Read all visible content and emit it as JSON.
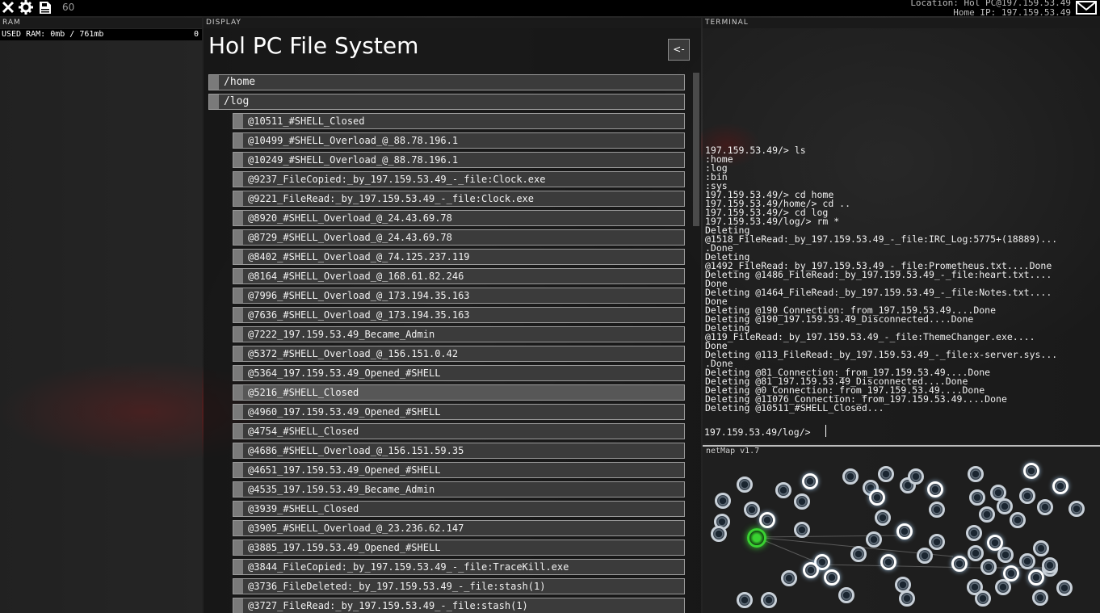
{
  "topbar": {
    "fps": "60",
    "location_line": "Location: Hol PC@197.159.53.49",
    "home_ip_line": "Home IP: 197.159.53.49",
    "icons": [
      "close-icon",
      "gear-icon",
      "save-icon",
      "mail-icon"
    ]
  },
  "ram": {
    "label": "RAM",
    "used_label": "USED RAM: 0mb / 761mb",
    "count": "0"
  },
  "display": {
    "label": "DISPLAY",
    "title": "Hol PC File System",
    "back_label": "<-",
    "dirs": [
      "/home",
      "/log"
    ],
    "files": [
      "@10511_#SHELL_Closed",
      "@10499_#SHELL_Overload_@_88.78.196.1",
      "@10249_#SHELL_Overload_@_88.78.196.1",
      "@9237_FileCopied:_by_197.159.53.49_-_file:Clock.exe",
      "@9221_FileRead:_by_197.159.53.49_-_file:Clock.exe",
      "@8920_#SHELL_Overload_@_24.43.69.78",
      "@8729_#SHELL_Overload_@_24.43.69.78",
      "@8402_#SHELL_Overload_@_74.125.237.119",
      "@8164_#SHELL_Overload_@_168.61.82.246",
      "@7996_#SHELL_Overload_@_173.194.35.163",
      "@7636_#SHELL_Overload_@_173.194.35.163",
      "@7222_197.159.53.49_Became_Admin",
      "@5372_#SHELL_Overload_@_156.151.0.42",
      "@5364_197.159.53.49_Opened_#SHELL",
      "@5216_#SHELL_Closed",
      "@4960_197.159.53.49_Opened_#SHELL",
      "@4754_#SHELL_Closed",
      "@4686_#SHELL_Overload_@_156.151.59.35",
      "@4651_197.159.53.49_Opened_#SHELL",
      "@4535_197.159.53.49_Became_Admin",
      "@3939_#SHELL_Closed",
      "@3905_#SHELL_Overload_@_23.236.62.147",
      "@3885_197.159.53.49_Opened_#SHELL",
      "@3844_FileCopied:_by_197.159.53.49_-_file:TraceKill.exe",
      "@3736_FileDeleted:_by_197.159.53.49_-_file:stash(1)",
      "@3727_FileRead:_by_197.159.53.49_-_file:stash(1)"
    ]
  },
  "terminal": {
    "label": "TERMINAL",
    "lines": [
      "197.159.53.49/> ls",
      ":home",
      ":log",
      ":bin",
      ":sys",
      "197.159.53.49/> cd home",
      "197.159.53.49/home/> cd ..",
      "197.159.53.49/> cd log",
      "197.159.53.49/log/> rm *",
      "Deleting",
      "@1518_FileRead:_by_197.159.53.49_-_file:IRC_Log:5775+(18889)...",
      ".Done",
      "Deleting",
      "@1492_FileRead:_by_197.159.53.49_-_file:Prometheus.txt....Done",
      "Deleting @1486_FileRead:_by_197.159.53.49_-_file:heart.txt....",
      "Done",
      "Deleting @1464_FileRead:_by_197.159.53.49_-_file:Notes.txt....",
      "Done",
      "Deleting @190_Connection:_from_197.159.53.49....Done",
      "Deleting @190_197.159.53.49_Disconnected....Done",
      "Deleting",
      "@119_FileRead:_by_197.159.53.49_-_file:ThemeChanger.exe....",
      "Done",
      "Deleting @113_FileRead:_by_197.159.53.49_-_file:x-server.sys...",
      ".Done",
      "Deleting @81_Connection:_from_197.159.53.49....Done",
      "Deleting @81_197.159.53.49_Disconnected....Done",
      "Deleting @0_Connection:_from_197.159.53.49....Done",
      "Deleting @11076_Connection:_from_197.159.53.49....Done",
      "Deleting @10511_#SHELL_Closed..."
    ],
    "prompt": "197.159.53.49/log/>"
  },
  "netmap": {
    "label": "netMap v1.7"
  }
}
